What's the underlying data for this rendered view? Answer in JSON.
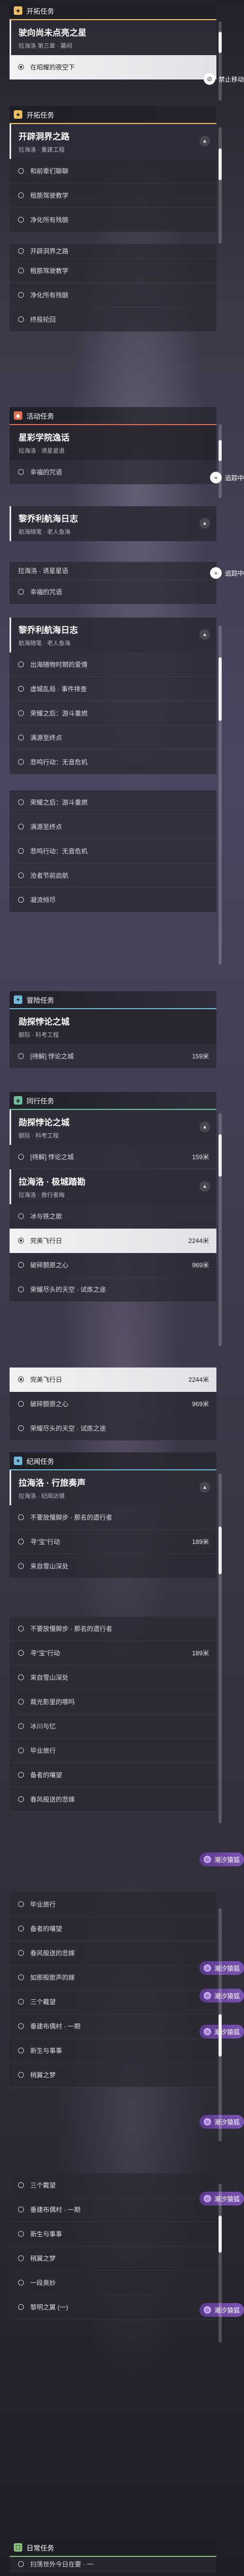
{
  "categories": {
    "trailblaze": "开拓任务",
    "event": "活动任务",
    "adventure": "冒险任务",
    "companion": "同行任务",
    "companion2": "纪闻任务",
    "daily": "日常任务"
  },
  "labels": {
    "forbidden": "禁止移动",
    "tracking": "追踪中",
    "sea_mark": "潮汐猿狐"
  },
  "missions": {
    "m1": {
      "title": "驶向尚未点亮之星",
      "sub": "拉海洛 第三章 · 幕间",
      "step": "在昭耀的夜空下"
    },
    "m2": {
      "title": "开辟洞界之路",
      "sub": "拉海洛 · 重建工程",
      "steps": [
        "和前辈们聊聊",
        "租筋驾驶教学",
        "净化所有残骸"
      ]
    },
    "m3": {
      "title": "开辟洞界之路",
      "steps": [
        "租筋驾驶教学",
        "净化所有残骸",
        "终极轮回"
      ]
    },
    "m4": {
      "title": "星彩学院逸话",
      "sub": "拉海洛 · 诱星星语",
      "step": "幸福的咒语"
    },
    "m5": {
      "title": "黎乔利航海日志",
      "sub": "航海随笔 · 老人鱼海"
    },
    "m6": {
      "sub": "拉海洛 · 诱星星语",
      "step": "幸福的咒语"
    },
    "m7": {
      "title": "黎乔利航海日志",
      "sub": "航海随笔 · 老人鱼海",
      "steps": [
        "出海随物时期的爱情",
        "虚城乱局 · 事件排查",
        "荣耀之后：游斗重燃",
        "满源至终点",
        "悲鸣行动：无音危机",
        "荣耀之后：游斗重燃",
        "满源至终点",
        "悲鸣行动：无音危机",
        "沧者节前启航",
        "凝流倾尽"
      ]
    },
    "m8": {
      "title": "勋探悖论之城",
      "sub": "额际 · 科考工程",
      "step": "[待解] 悖论之城",
      "dist": "159米"
    },
    "m9": {
      "title": "勋探悖论之城",
      "sub": "额际 · 科考工程",
      "step": "[待解] 悖论之城",
      "dist": "159米"
    },
    "m10": {
      "title": "拉海洛 · 极城踏勘",
      "sub": "拉海洛 · 救行者梅",
      "steps": [
        "冰与铁之歌",
        "完美飞行日",
        "破碎颤原之心",
        "荣耀尽头的天空 · 试炼之途"
      ],
      "dists": [
        "",
        "2244米",
        "969米",
        ""
      ]
    },
    "m11": {
      "steps": [
        "完美飞行日",
        "破碎颤原之心",
        "荣耀尽头的天空 · 试炼之途"
      ],
      "dists": [
        "2244米",
        "969米",
        ""
      ]
    },
    "m12": {
      "title": "拉海洛 · 行旅奏声",
      "sub": "拉海洛 · 纪闻访镜",
      "steps": [
        "不要放慢脚步 · 那名的遗行者",
        "寻“宝”行动",
        "来自雪山深处"
      ],
      "dists": [
        "",
        "189米",
        ""
      ]
    },
    "m13": {
      "steps": [
        "不要放慢脚步 · 那名的遗行者",
        "寻“宝”行动",
        "来自雪山深处",
        "裁光影里的哪吗",
        "冰川与忆",
        "毕业旅行",
        "备者的嚷望",
        "春风般送的悲嫁"
      ],
      "dists": [
        "",
        "189米",
        "",
        "",
        "",
        "",
        "",
        ""
      ]
    },
    "m14": {
      "steps": [
        "毕业旅行",
        "备者的嚷望",
        "春风般送的悲嫁",
        "如那般歌声的嫁",
        "三个戴望",
        "垂建布偶村 · 一期",
        "新生与事事",
        "稍翼之梦"
      ]
    },
    "m15": {
      "steps": [
        "三个戴望",
        "垂建布偶村 · 一期",
        "新生与事事",
        "稍翼之梦",
        "一段奥妙",
        "黎明之翼 (一)"
      ]
    },
    "m16": {
      "step": "扫荡世外今日在要 · 一"
    }
  }
}
